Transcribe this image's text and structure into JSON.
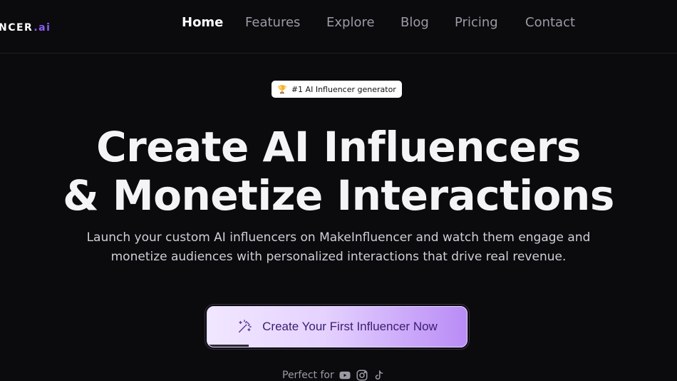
{
  "nav": {
    "logo_text": "NCER",
    "logo_suffix": ".ai",
    "links": [
      "Home",
      "Features",
      "Explore",
      "Blog",
      "Pricing",
      "Contact"
    ]
  },
  "hero": {
    "badge_icon": "trophy-icon",
    "badge_text": "#1 AI Influencer generator",
    "headline_line1": "Create AI Influencers",
    "headline_line2": "& Monetize Interactions",
    "subtitle_line1": "Launch your custom AI influencers on MakeInfluencer and watch them engage and",
    "subtitle_line2": "monetize audiences with personalized interactions that drive real revenue.",
    "cta_label": "Create Your First Influencer Now",
    "cta_icon": "magic-wand-icon",
    "perfect_for_label": "Perfect for",
    "social_icons": [
      "youtube-icon",
      "instagram-icon",
      "tiktok-icon"
    ]
  },
  "colors": {
    "background": "#0b0b0e",
    "accent": "#8b5cf6",
    "cta_gradient_start": "#f1e7ff",
    "cta_gradient_end": "#b98bf6",
    "nav_inactive": "#9b9ba5"
  }
}
